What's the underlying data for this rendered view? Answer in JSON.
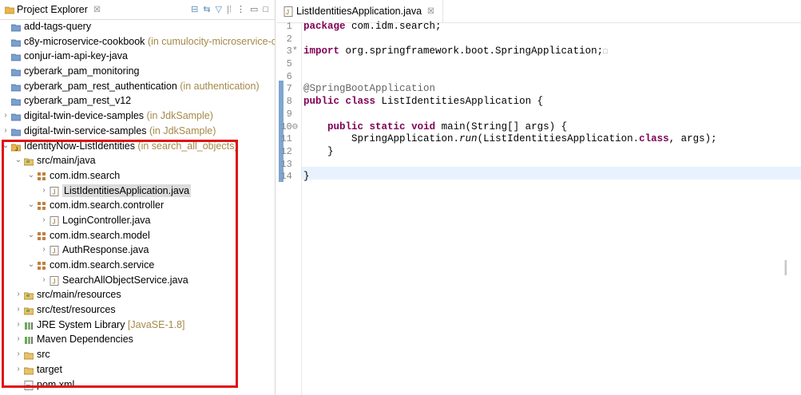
{
  "project_explorer": {
    "title": "Project Explorer",
    "close": "☒",
    "toolbar_icons": [
      "collapse-all-icon",
      "link-editor-icon",
      "filter-icon",
      "focus-icon",
      "view-menu-icon",
      "minimize-icon",
      "maximize-icon"
    ],
    "items": [
      {
        "label": "add-tags-query",
        "decoration": "",
        "arrow": "",
        "type": "project"
      },
      {
        "label": "c8y-microservice-cookbook",
        "decoration": "(in cumulocity-microservice-coo",
        "arrow": "",
        "type": "project"
      },
      {
        "label": "conjur-iam-api-key-java",
        "decoration": "",
        "arrow": "",
        "type": "project"
      },
      {
        "label": "cyberark_pam_monitoring",
        "decoration": "",
        "arrow": "",
        "type": "project"
      },
      {
        "label": "cyberark_pam_rest_authentication",
        "decoration": "(in authentication)",
        "arrow": "",
        "type": "project"
      },
      {
        "label": "cyberark_pam_rest_v12",
        "decoration": "",
        "arrow": "",
        "type": "project"
      },
      {
        "label": "digital-twin-device-samples",
        "decoration": "(in JdkSample)",
        "arrow": "›",
        "type": "project"
      },
      {
        "label": "digital-twin-service-samples",
        "decoration": "(in JdkSample)",
        "arrow": "›",
        "type": "project"
      },
      {
        "label": "IdentityNow-ListIdentities",
        "decoration": "(in search_all_objects)",
        "arrow": "⌄",
        "type": "maven-project"
      },
      {
        "label": "src/main/java",
        "decoration": "",
        "arrow": "⌄",
        "type": "source-folder"
      },
      {
        "label": "com.idm.search",
        "decoration": "",
        "arrow": "⌄",
        "type": "package"
      },
      {
        "label": "ListIdentitiesApplication.java",
        "decoration": "",
        "arrow": "›",
        "type": "java-file",
        "selected": true
      },
      {
        "label": "com.idm.search.controller",
        "decoration": "",
        "arrow": "⌄",
        "type": "package"
      },
      {
        "label": "LoginController.java",
        "decoration": "",
        "arrow": "›",
        "type": "java-file"
      },
      {
        "label": "com.idm.search.model",
        "decoration": "",
        "arrow": "⌄",
        "type": "package"
      },
      {
        "label": "AuthResponse.java",
        "decoration": "",
        "arrow": "›",
        "type": "java-file"
      },
      {
        "label": "com.idm.search.service",
        "decoration": "",
        "arrow": "⌄",
        "type": "package"
      },
      {
        "label": "SearchAllObjectService.java",
        "decoration": "",
        "arrow": "›",
        "type": "java-file"
      },
      {
        "label": "src/main/resources",
        "decoration": "",
        "arrow": "›",
        "type": "source-folder"
      },
      {
        "label": "src/test/resources",
        "decoration": "",
        "arrow": "›",
        "type": "source-folder"
      },
      {
        "label": "JRE System Library",
        "decoration": "[JavaSE-1.8]",
        "arrow": "›",
        "type": "library"
      },
      {
        "label": "Maven Dependencies",
        "decoration": "",
        "arrow": "›",
        "type": "library"
      },
      {
        "label": "src",
        "decoration": "",
        "arrow": "›",
        "type": "folder"
      },
      {
        "label": "target",
        "decoration": "",
        "arrow": "›",
        "type": "folder"
      },
      {
        "label": "pom.xml",
        "decoration": "",
        "arrow": "",
        "type": "xml-file"
      }
    ]
  },
  "editor": {
    "tab_title": "ListIdentitiesApplication.java",
    "tab_close": "☒",
    "line_numbers": [
      "1",
      "2",
      "3",
      "5",
      "6",
      "7",
      "8",
      "9",
      "10",
      "11",
      "12",
      "13",
      "14"
    ],
    "lines": [
      {
        "parts": [
          {
            "t": "package",
            "c": "kw"
          },
          {
            "t": " com.idm.search;",
            "c": ""
          }
        ]
      },
      {
        "parts": [
          {
            "t": "",
            "c": ""
          }
        ]
      },
      {
        "parts": [
          {
            "t": "import",
            "c": "kw"
          },
          {
            "t": " org.springframework.boot.SpringApplication;",
            "c": ""
          },
          {
            "t": "□",
            "c": "fold"
          }
        ]
      },
      {
        "parts": [
          {
            "t": "",
            "c": ""
          }
        ]
      },
      {
        "parts": [
          {
            "t": "",
            "c": ""
          }
        ]
      },
      {
        "parts": [
          {
            "t": "@SpringBootApplication",
            "c": "ann"
          }
        ]
      },
      {
        "parts": [
          {
            "t": "public",
            "c": "kw"
          },
          {
            "t": " ",
            "c": ""
          },
          {
            "t": "class",
            "c": "kw"
          },
          {
            "t": " ListIdentitiesApplication {",
            "c": ""
          }
        ]
      },
      {
        "parts": [
          {
            "t": "",
            "c": ""
          }
        ]
      },
      {
        "parts": [
          {
            "t": "    ",
            "c": ""
          },
          {
            "t": "public",
            "c": "kw"
          },
          {
            "t": " ",
            "c": ""
          },
          {
            "t": "static",
            "c": "kw"
          },
          {
            "t": " ",
            "c": ""
          },
          {
            "t": "void",
            "c": "kw"
          },
          {
            "t": " main(String[] args) {",
            "c": ""
          }
        ]
      },
      {
        "parts": [
          {
            "t": "        SpringApplication.",
            "c": ""
          },
          {
            "t": "run",
            "c": "mth"
          },
          {
            "t": "(ListIdentitiesApplication.",
            "c": ""
          },
          {
            "t": "class",
            "c": "kw"
          },
          {
            "t": ", args);",
            "c": ""
          }
        ]
      },
      {
        "parts": [
          {
            "t": "    }",
            "c": ""
          }
        ]
      },
      {
        "parts": [
          {
            "t": "",
            "c": ""
          }
        ]
      },
      {
        "parts": [
          {
            "t": "}",
            "c": ""
          }
        ]
      }
    ],
    "line_markers": {
      "3": "*",
      "10": "⊖"
    }
  }
}
